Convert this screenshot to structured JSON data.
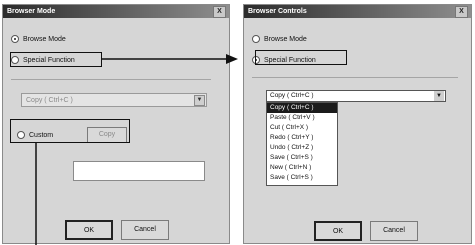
{
  "left_dialog": {
    "title": "Browser Mode",
    "close_glyph": "X",
    "radio_browse": "Browse Mode",
    "radio_special": "Special Function",
    "combo_value": "Copy ( Ctrl+C )",
    "check_custom": "Custom",
    "custom_value": "Copy",
    "ok_label": "OK",
    "cancel_label": "Cancel"
  },
  "right_dialog": {
    "title": "Browser Controls",
    "close_glyph": "X",
    "radio_browse": "Browse Mode",
    "radio_special": "Special Function",
    "combo_value": "Copy ( Ctrl+C )",
    "list_items": [
      "Copy ( Ctrl+C )",
      "Paste ( Ctrl+V )",
      "Cut ( Ctrl+X )",
      "Redo ( Ctrl+Y )",
      "Undo ( Ctrl+Z )",
      "Save ( Ctrl+S )",
      "New ( Ctrl+N )",
      "Save ( Ctrl+S )"
    ],
    "selected_index": 0,
    "ok_label": "OK",
    "cancel_label": "Cancel"
  }
}
